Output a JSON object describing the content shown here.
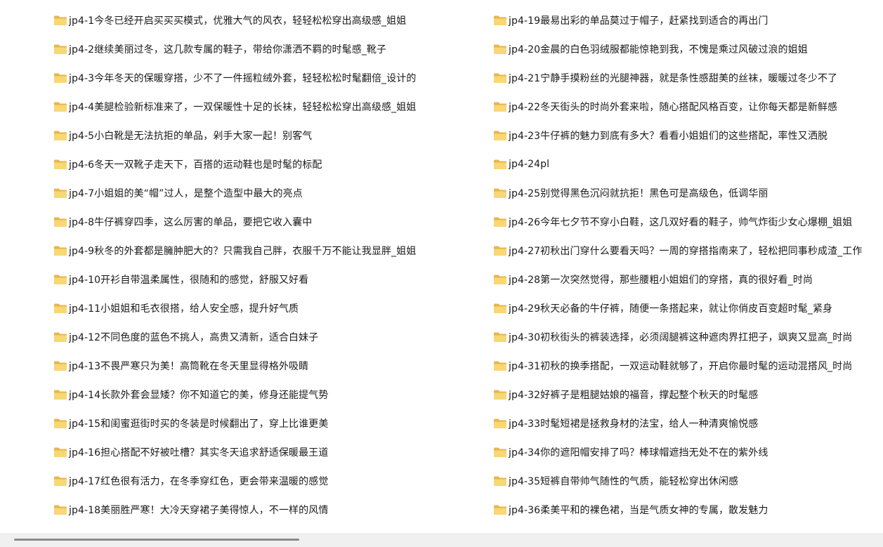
{
  "icon": "folder-icon",
  "colors": {
    "folder_back": "#e8b64a",
    "folder_front": "#f8d775",
    "scrollbar_track": "#f0f0f0",
    "scrollbar_thumb": "#8a8a8a"
  },
  "left_items": [
    "jp4-1今冬已经开启买买买模式，优雅大气的风衣，轻轻松松穿出高级感_姐姐",
    "jp4-2继续美丽过冬，这几款专属的鞋子，带给你潇洒不羁的时髦感_靴子",
    "jp4-3今年冬天的保暖穿搭，少不了一件摇粒绒外套，轻轻松松时髦翻倍_设计的",
    "jp4-4美腿检验新标准来了，一双保暖性十足的长袜，轻轻松松穿出高级感_姐姐",
    "jp4-5小白靴是无法抗拒的单品，剁手大家一起！别客气",
    "jp4-6冬天一双靴子走天下，百搭的运动鞋也是时髦的标配",
    "jp4-7小姐姐的美“帽”过人，是整个造型中最大的亮点",
    "jp4-8牛仔裤穿四季，这么厉害的单品，要把它收入囊中",
    "jp4-9秋冬的外套都是臃肿肥大的？只需我自己胖，衣服千万不能让我显胖_姐姐",
    "jp4-10开衫自带温柔属性，很随和的感觉，舒服又好看",
    "jp4-11小姐姐和毛衣很搭，给人安全感，提升好气质",
    "jp4-12不同色度的蓝色不挑人，高贵又清新，适合白妹子",
    "jp4-13不畏严寒只为美！高筒靴在冬天里显得格外吸睛",
    "jp4-14长款外套会显矮？你不知道它的美，修身还能提气势",
    "jp4-15和闺蜜逛街时买的冬装是时候翻出了，穿上比谁更美",
    "jp4-16担心搭配不好被吐槽？其实冬天追求舒适保暖最王道",
    "jp4-17红色很有活力，在冬季穿红色，更会带来温暖的感觉",
    "jp4-18美丽胜严寒！大冷天穿裙子美得惊人，不一样的风情"
  ],
  "right_items": [
    "jp4-19最易出彩的单品莫过于帽子，赶紧找到适合的再出门",
    "jp4-20金晨的白色羽绒服都能惊艳到我，不愧是乘过风破过浪的姐姐",
    "jp4-21宁静手摸粉丝的光腿神器，就是条性感甜美的丝袜，暖暖过冬少不了",
    "jp4-22冬天街头的时尚外套来啦，随心搭配风格百变，让你每天都是新鲜感",
    "jp4-23牛仔裤的魅力到底有多大？看看小姐姐们的这些搭配，率性又洒脱",
    "jp4-24pl",
    "jp4-25别觉得黑色沉闷就抗拒！黑色可是高级色，低调华丽",
    "jp4-26今年七夕节不穿小白鞋，这几双好看的鞋子，帅气炸街少女心爆棚_姐姐",
    "jp4-27初秋出门穿什么要看天吗？一周的穿搭指南来了，轻松把同事秒成渣_工作",
    "jp4-28第一次突然觉得，那些腰粗小姐姐们的穿搭，真的很好看_时尚",
    "jp4-29秋天必备的牛仔裤，随便一条搭起来，就让你俏皮百变超时髦_紧身",
    "jp4-30初秋街头的裤装选择，必须阔腿裤这种遮肉界扛把子，飒爽又显高_时尚",
    "jp4-31初秋的换季搭配，一双运动鞋就够了，开启你最时髦的运动混搭风_时尚",
    "jp4-32好裤子是粗腿姑娘的福音，撑起整个秋天的时髦感",
    "jp4-33时髦短裙是拯救身材的法宝，给人一种清爽愉悦感",
    "jp4-34你的遮阳帽安排了吗？棒球帽遮挡无处不在的紫外线",
    "jp4-35短裤自带帅气随性的气质，能轻松穿出休闲感",
    "jp4-36柔美平和的裸色裙，当是气质女神的专属，散发魅力"
  ]
}
